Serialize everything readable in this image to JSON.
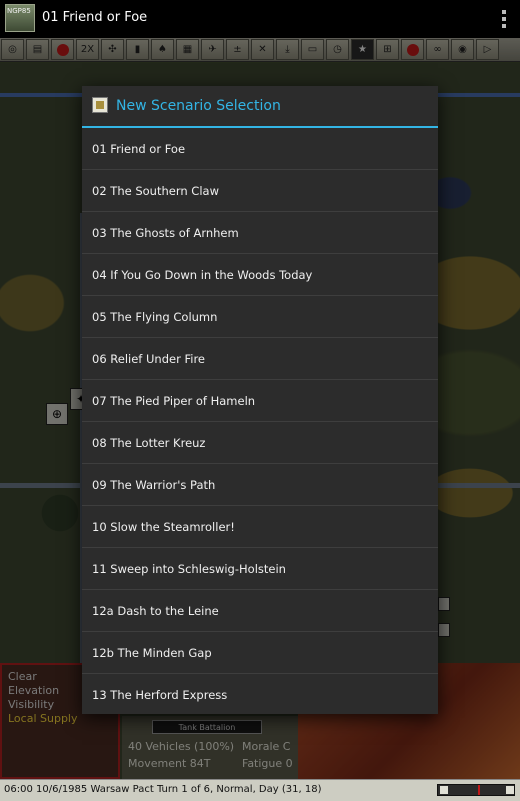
{
  "app": {
    "icon_text": "NGP85",
    "title": "01 Friend or Foe",
    "overflow_icon": "overflow-menu-icon"
  },
  "toolbar": {
    "zoom_label": "2X",
    "buttons": [
      "target-icon",
      "document-icon",
      "radio-icon",
      "zoom-2x-icon",
      "crosshair-icon",
      "ammo-icon",
      "shovel-icon",
      "map-icon",
      "aircraft-icon",
      "plus-minus-icon",
      "cancel-icon",
      "download-icon",
      "vehicle-icon",
      "clock-icon",
      "star-icon",
      "hierarchy-icon",
      "red-dot-icon",
      "binoculars-icon",
      "settings-icon",
      "next-icon"
    ]
  },
  "terrain": {
    "line1": "Clear",
    "line2": "Elevation",
    "line3": "Visibility",
    "line4": "Local Supply"
  },
  "unit_info": {
    "type": "Tank Battalion",
    "vehicles": "40 Vehicles (100%)",
    "morale": "Morale C",
    "movement": "Movement 84T",
    "fatigue": "Fatigue 0"
  },
  "status": {
    "text": "06:00 10/6/1985 Warsaw Pact Turn 1 of 6, Normal, Day (31, 18)"
  },
  "dialog": {
    "title": "New Scenario Selection",
    "icon": "scenario-icon",
    "accent_color": "#33b5e5",
    "scenarios": [
      "01 Friend or Foe",
      "02 The Southern Claw",
      "03 The Ghosts of Arnhem",
      "04 If You Go Down in the Woods Today",
      "05 The Flying Column",
      "06 Relief Under Fire",
      "07 The Pied Piper of Hameln",
      "08 The Lotter Kreuz",
      "09 The Warrior's Path",
      "10 Slow the Steamroller!",
      "11 Sweep into Schleswig-Holstein",
      "12a Dash to the Leine",
      "12b The Minden Gap",
      "13 The Herford Express"
    ]
  }
}
